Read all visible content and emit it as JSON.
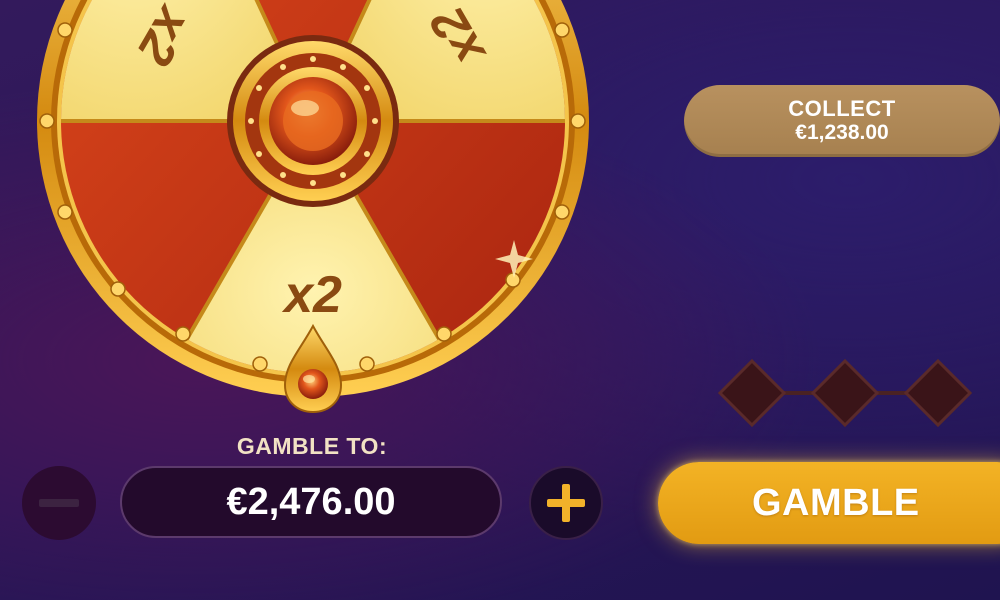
{
  "wheel": {
    "segment_label": "x2",
    "colors": {
      "gold": "#f6e27a",
      "red": "#c9361a",
      "rim": "#e2a21c"
    }
  },
  "collect": {
    "label": "COLLECT",
    "amount": "€1,238.00"
  },
  "gamble_to": {
    "label": "GAMBLE TO:",
    "value": "€2,476.00"
  },
  "controls": {
    "minus_icon": "minus-icon",
    "plus_icon": "plus-icon"
  },
  "gamble_button": {
    "label": "GAMBLE"
  },
  "progress": {
    "steps_total": 3,
    "steps_filled": 0
  }
}
